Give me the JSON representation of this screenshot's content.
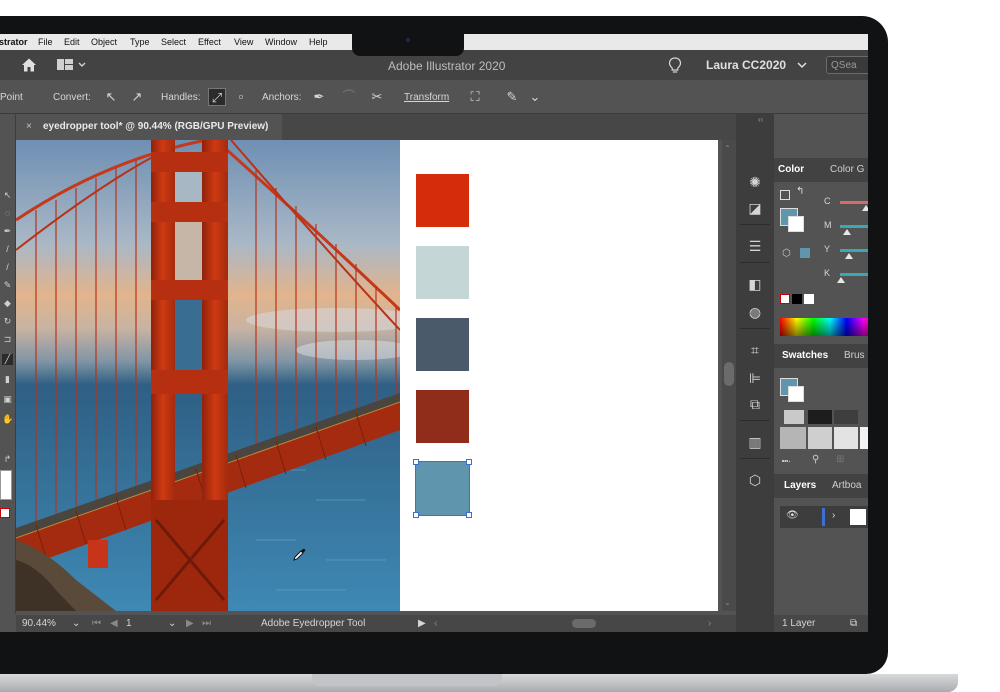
{
  "menu": {
    "app": "Illustrator",
    "items": [
      "File",
      "Edit",
      "Object",
      "Type",
      "Select",
      "Effect",
      "View",
      "Window",
      "Help"
    ]
  },
  "appbar": {
    "title": "Adobe Illustrator 2020",
    "user": "Laura CC2020",
    "search_placeholder": "Sea"
  },
  "control": {
    "point_label": "Point",
    "convert_label": "Convert:",
    "handles_label": "Handles:",
    "anchors_label": "Anchors:",
    "transform_label": "Transform"
  },
  "document": {
    "tab_title": "eyedropper tool* @ 90.44% (RGB/GPU Preview)",
    "close_glyph": "×"
  },
  "status": {
    "zoom": "90.44%",
    "artboard_number": "1",
    "tool_name": "Adobe Eyedropper Tool"
  },
  "swatches_on_artboard": [
    {
      "color": "#d52c0c"
    },
    {
      "color": "#c5d6d7"
    },
    {
      "color": "#4a5a6b"
    },
    {
      "color": "#8f2d1a"
    },
    {
      "color": "#5f96ad",
      "selected": true
    }
  ],
  "panels": {
    "color_tab": "Color",
    "color_guide_tab": "Color G",
    "sliders": [
      {
        "label": "C",
        "value": 0.62,
        "color": "#d56b6b"
      },
      {
        "label": "M",
        "value": 0.15,
        "color": "#3aa7b6"
      },
      {
        "label": "Y",
        "value": 0.2,
        "color": "#3aa7b6"
      },
      {
        "label": "K",
        "value": 0.0,
        "color": "#3aa7b6"
      }
    ],
    "fill_color": "#5f96ad",
    "swatches_tab": "Swatches",
    "brushes_tab": "Brus",
    "layers_tab": "Layers",
    "artboards_tab": "Artboa",
    "layer_count": "1 Layer"
  },
  "icons": {
    "home": "home-icon",
    "workspace": "workspace-switcher-icon",
    "lightbulb": "lightbulb-icon",
    "search": "search-icon",
    "eyedropper_cursor": "eyedropper-cursor-icon"
  }
}
